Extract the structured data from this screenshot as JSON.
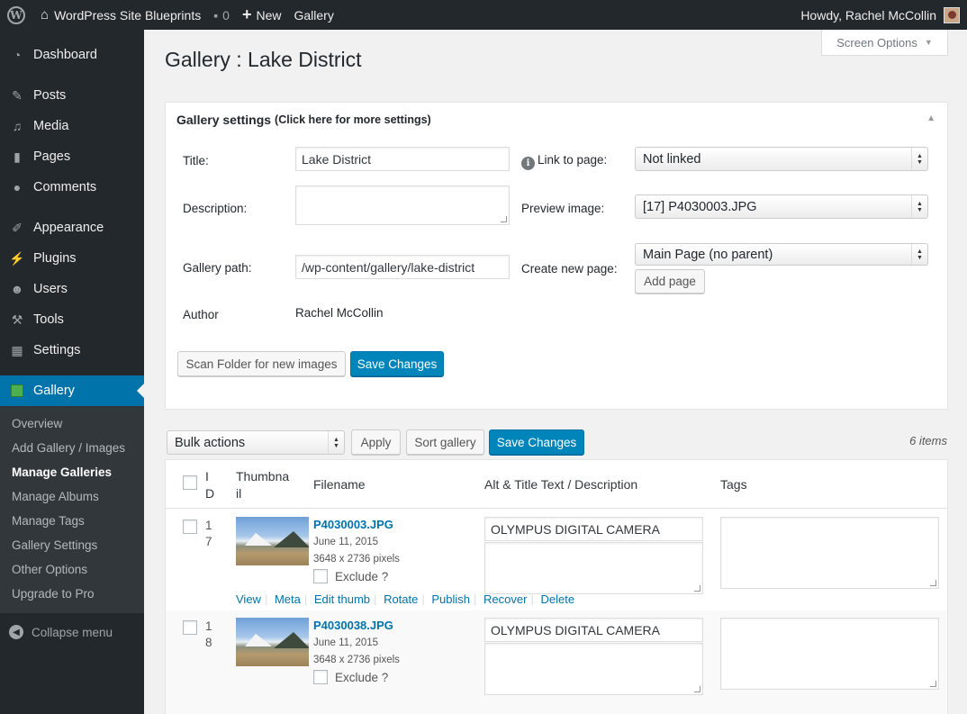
{
  "adminbar": {
    "site_name": "WordPress Site Blueprints",
    "comments_count": "0",
    "new_label": "New",
    "gallery_label": "Gallery",
    "howdy": "Howdy, Rachel McCollin"
  },
  "sidebar": {
    "items": [
      {
        "label": "Dashboard",
        "icon": "dashboard-icon"
      },
      {
        "label": "Posts",
        "icon": "pin-icon"
      },
      {
        "label": "Media",
        "icon": "media-icon"
      },
      {
        "label": "Pages",
        "icon": "pages-icon"
      },
      {
        "label": "Comments",
        "icon": "comment-icon"
      },
      {
        "label": "Appearance",
        "icon": "brush-icon"
      },
      {
        "label": "Plugins",
        "icon": "plugin-icon"
      },
      {
        "label": "Users",
        "icon": "user-icon"
      },
      {
        "label": "Tools",
        "icon": "wrench-icon"
      },
      {
        "label": "Settings",
        "icon": "settings-icon"
      },
      {
        "label": "Gallery",
        "icon": "gallery-icon"
      }
    ],
    "submenu": [
      "Overview",
      "Add Gallery / Images",
      "Manage Galleries",
      "Manage Albums",
      "Manage Tags",
      "Gallery Settings",
      "Other Options",
      "Upgrade to Pro"
    ],
    "collapse": "Collapse menu"
  },
  "screen_options": "Screen Options",
  "page_title": "Gallery : Lake District",
  "settings": {
    "heading": "Gallery settings",
    "heading_hint": "(Click here for more settings)",
    "title_label": "Title:",
    "title_value": "Lake District",
    "description_label": "Description:",
    "description_value": "",
    "path_label": "Gallery path:",
    "path_value": "/wp-content/gallery/lake-district",
    "author_label": "Author",
    "author_value": "Rachel McCollin",
    "link_label": "Link to page:",
    "link_value": "Not linked",
    "preview_label": "Preview image:",
    "preview_value": "[17] P4030003.JPG",
    "create_label": "Create new page:",
    "create_value": "Main Page (no parent)",
    "add_page": "Add page",
    "scan_button": "Scan Folder for new images",
    "save_button": "Save Changes"
  },
  "toolbar": {
    "bulk_actions": "Bulk actions",
    "apply": "Apply",
    "sort": "Sort gallery",
    "save": "Save Changes",
    "count": "6 items"
  },
  "table": {
    "headers": {
      "id_1": "I",
      "id_2": "D",
      "thumb_1": "Thumbna",
      "thumb_2": "il",
      "filename": "Filename",
      "alt": "Alt & Title Text / Description",
      "tags": "Tags"
    },
    "rows": [
      {
        "id_1": "1",
        "id_2": "7",
        "filename": "P4030003.JPG",
        "date": "June 11, 2015",
        "size": "3648 x 2736 pixels",
        "exclude": "Exclude ?",
        "alt": "OLYMPUS DIGITAL CAMERA",
        "description": "",
        "tags": ""
      },
      {
        "id_1": "1",
        "id_2": "8",
        "filename": "P4030038.JPG",
        "date": "June 11, 2015",
        "size": "3648 x 2736 pixels",
        "exclude": "Exclude ?",
        "alt": "OLYMPUS DIGITAL CAMERA",
        "description": "",
        "tags": ""
      }
    ],
    "row_actions": [
      "View",
      "Meta",
      "Edit thumb",
      "Rotate",
      "Publish",
      "Recover",
      "Delete"
    ]
  }
}
